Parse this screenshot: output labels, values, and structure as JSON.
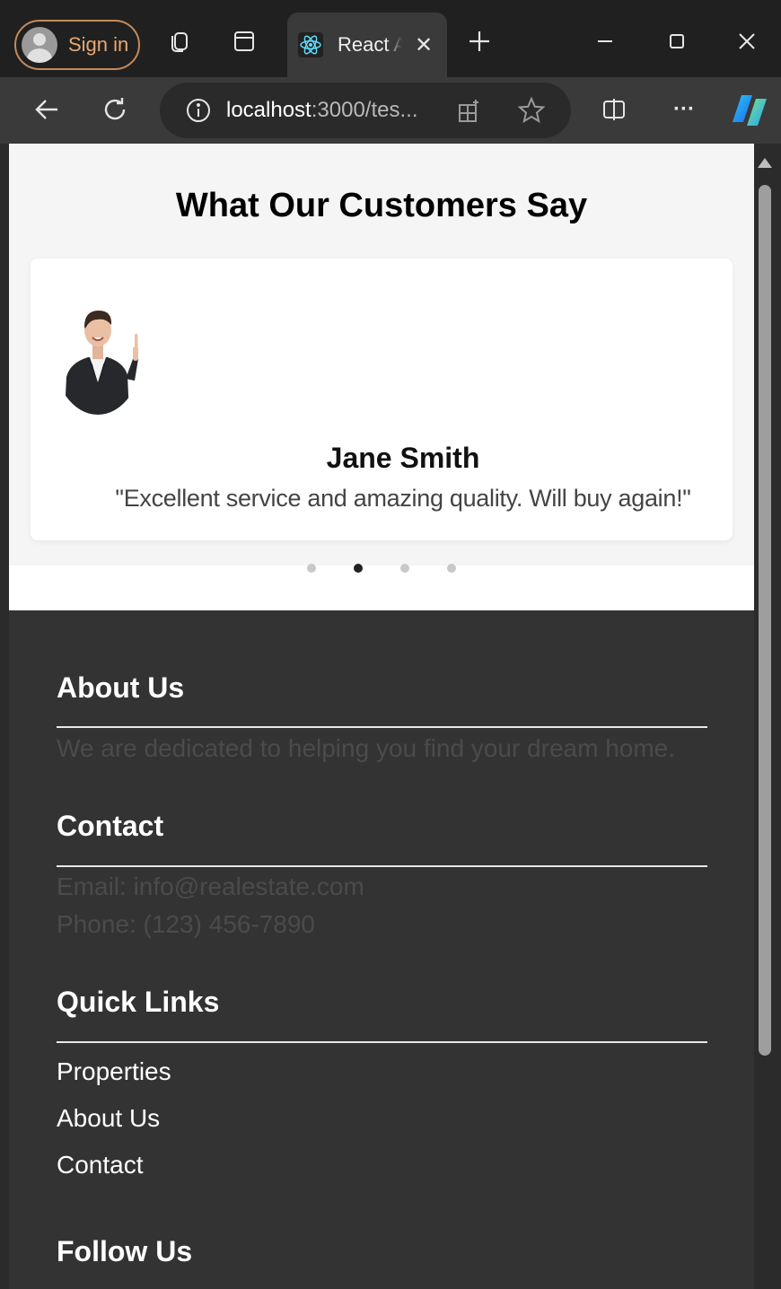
{
  "browser": {
    "sign_in_label": "Sign in",
    "tab_title": "React App",
    "url_host": "localhost",
    "url_rest": ":3000/tes...",
    "icons": [
      "workspaces-icon",
      "tab-actions-icon",
      "react-favicon",
      "close-tab-icon",
      "new-tab-icon",
      "minimize-icon",
      "maximize-icon",
      "close-window-icon",
      "back-icon",
      "refresh-icon",
      "site-info-icon",
      "apps-icon",
      "favorite-icon",
      "split-screen-icon",
      "more-icon",
      "copilot-icon"
    ],
    "more_label": "···"
  },
  "testimonials": {
    "title": "What Our Customers Say",
    "customer_name": "Jane Smith",
    "quote": "\"Excellent service and amazing quality. Will buy again!\"",
    "slide_count": 4,
    "active_slide": 2
  },
  "footer": {
    "about_heading": "About Us",
    "about_text": "We are dedicated to helping you find your dream home.",
    "contact_heading": "Contact",
    "email": "Email: info@realestate.com",
    "phone": "Phone: (123) 456-7890",
    "links_heading": "Quick Links",
    "links": [
      "Properties",
      "About Us",
      "Contact"
    ],
    "follow_heading": "Follow Us"
  },
  "colors": {
    "footer_bg": "#333333",
    "accent_sign_in": "#e8a874",
    "footer_muted_text": "#4b4b4b"
  }
}
